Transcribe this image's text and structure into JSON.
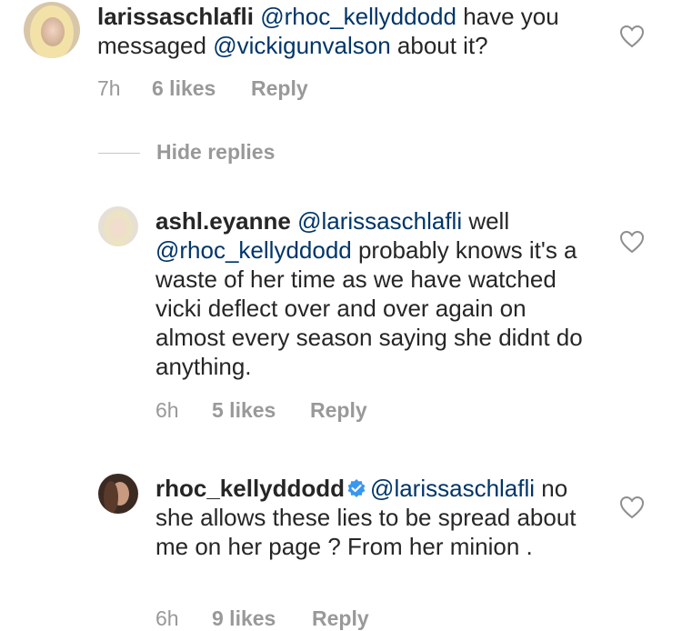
{
  "comments": [
    {
      "username": "larissaschlafli",
      "mention": "@rhoc_kellyddodd",
      "text_a": " have you messaged ",
      "mention_b": "@vickigunvalson",
      "text_b": " about it?",
      "time": "7h",
      "likes": "6 likes",
      "reply": "Reply"
    },
    {
      "username": "ashl.eyanne",
      "mention": "@larissaschlafli",
      "text_a": " well ",
      "mention_b": "@rhoc_kellyddodd",
      "text_b": " probably knows it's a waste of her time as we have watched vicki deflect over and over again on almost every season saying she didnt do anything.",
      "time": "6h",
      "likes": "5 likes",
      "reply": "Reply"
    },
    {
      "username": "rhoc_kellyddodd",
      "mention": "@larissaschlafli",
      "text_a": " no she allows these lies to be spread about me on her page ? From her minion .",
      "time": "6h",
      "likes": "9 likes",
      "reply": "Reply"
    }
  ],
  "hide_replies": "Hide replies",
  "colors": {
    "mention": "#003569",
    "meta": "#999999",
    "verified": "#3897f0"
  }
}
